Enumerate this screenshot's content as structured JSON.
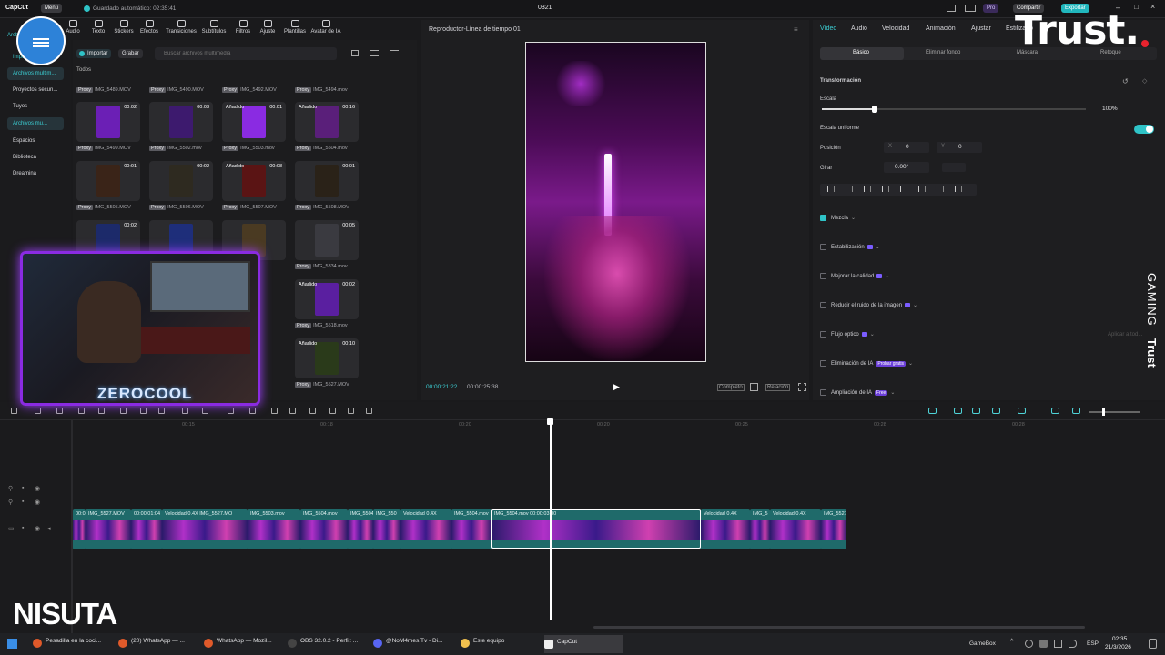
{
  "topbar": {
    "app_name": "CapCut",
    "menu_label": "Menú",
    "autosave": "Guardado automático: 02:35:41",
    "project_name": "0321",
    "pro_label": "Pro",
    "share_label": "Compartir",
    "export_label": "Exportar"
  },
  "toolbar": {
    "items": [
      "Audio",
      "Texto",
      "Stickers",
      "Efectos",
      "Transiciones",
      "Subtítulos",
      "Filtros",
      "Ajuste",
      "Plantillas",
      "Avatar de IA"
    ],
    "left_tab": "Archiv"
  },
  "leftnav": {
    "items": [
      "Importación",
      "Archivos multim...",
      "Proyectos secun...",
      "Tuyos",
      "Archivos mu...",
      "Espacios",
      "Biblioteca",
      "Dreamina"
    ]
  },
  "media": {
    "import_label": "Importar",
    "record_label": "Grabar",
    "search_placeholder": "Buscar archivos multimedia",
    "all_label": "Todos",
    "proxy_label": "Proxy",
    "added_label": "Añadido",
    "row0_captions": [
      "IMG_5489.MOV",
      "IMG_5490.MOV",
      "IMG_5492.MOV",
      "IMG_5494.mov"
    ],
    "grid": [
      {
        "dur": "00:02",
        "name": "IMG_5499.MOV",
        "added": false,
        "color": "#6b1fb5"
      },
      {
        "dur": "00:03",
        "name": "IMG_5502.mov",
        "added": false,
        "color": "#3d1a6e"
      },
      {
        "dur": "00:01",
        "name": "IMG_5503.mov",
        "added": true,
        "color": "#8a2be2"
      },
      {
        "dur": "00:16",
        "name": "IMG_5504.mov",
        "added": true,
        "color": "#5a1f7a"
      },
      {
        "dur": "00:01",
        "name": "IMG_5505.MOV",
        "added": false,
        "color": "#3a2418"
      },
      {
        "dur": "00:02",
        "name": "IMG_5506.MOV",
        "added": false,
        "color": "#2e2a20"
      },
      {
        "dur": "00:08",
        "name": "IMG_5507.MOV",
        "added": true,
        "color": "#5a1414"
      },
      {
        "dur": "00:01",
        "name": "IMG_5508.MOV",
        "added": false,
        "color": "#2a2218"
      },
      {
        "dur": "00:02",
        "name": "",
        "added": false,
        "color": "#1c2a6a"
      },
      {
        "dur": "",
        "name": "",
        "added": false,
        "color": "#1e2e7a"
      },
      {
        "dur": "",
        "name": "",
        "added": false,
        "color": "#4a3a22"
      },
      {
        "dur": "00:05",
        "name": "IMG_5334.mov",
        "added": false,
        "color": "#3a3a40"
      },
      {
        "dur": "00:02",
        "name": "IMG_5518.mov",
        "added": true,
        "color": "#5a1fa0"
      },
      {
        "dur": "00:10",
        "name": "IMG_5527.MOV",
        "added": true,
        "color": "#2a3a1a"
      }
    ]
  },
  "player": {
    "title": "Reproductor-Línea de tiempo 01",
    "current_time": "00:00:21:22",
    "total_time": "00:00:25:38",
    "ratio_label": "Completo",
    "proportion_label": "Relación"
  },
  "props": {
    "tabs": [
      "Vídeo",
      "Audio",
      "Velocidad",
      "Animación",
      "Ajustar",
      "Estilizado"
    ],
    "subtabs": [
      "Básico",
      "Eliminar fondo",
      "Máscara",
      "Retoque"
    ],
    "transform_label": "Transformación",
    "scale_label": "Escala",
    "scale_value": "100%",
    "scale_fraction": 0.2,
    "uniform_label": "Escala uniforme",
    "position_label": "Posición",
    "pos_x_label": "X",
    "pos_x": "0",
    "pos_y_label": "Y",
    "pos_y": "0",
    "rotate_label": "Girar",
    "rotate_value": "0.00°",
    "rotate_dash": "-",
    "options": [
      {
        "label": "Mezcla",
        "checked": true,
        "gem": false,
        "badge": ""
      },
      {
        "label": "Estabilización",
        "checked": false,
        "gem": true,
        "badge": ""
      },
      {
        "label": "Mejorar la calidad",
        "checked": false,
        "gem": true,
        "badge": ""
      },
      {
        "label": "Reducir el ruido de la imagen",
        "checked": false,
        "gem": true,
        "badge": ""
      },
      {
        "label": "Flujo óptico",
        "checked": false,
        "gem": true,
        "badge": ""
      },
      {
        "label": "Eliminación de IA",
        "checked": false,
        "gem": false,
        "badge": "Probar gratis"
      },
      {
        "label": "Ampliación de IA",
        "checked": false,
        "gem": false,
        "badge": "Free"
      }
    ],
    "apply_label": "Aplicar a tod..."
  },
  "timeline": {
    "ruler": [
      "00:15",
      "00:18",
      "00:20",
      "00:20",
      "00:25",
      "00:28",
      "00:28"
    ],
    "clips": [
      {
        "label": "00:0",
        "start": 80,
        "width": 14
      },
      {
        "label": "IMG_5527.MOV",
        "start": 94,
        "width": 50
      },
      {
        "label": "00:00:01:04",
        "start": 144,
        "width": 34
      },
      {
        "label": "Velocidad 0.4X  IMG_5527.MO",
        "start": 178,
        "width": 94
      },
      {
        "label": "IMG_5503.mov",
        "start": 272,
        "width": 58
      },
      {
        "label": "IMG_5504.mov",
        "start": 330,
        "width": 52
      },
      {
        "label": "IMG_5504",
        "start": 382,
        "width": 28
      },
      {
        "label": "IMG_550",
        "start": 410,
        "width": 30
      },
      {
        "label": "Velocidad 0.4X",
        "start": 440,
        "width": 56
      },
      {
        "label": "IMG_5504.mov",
        "start": 496,
        "width": 44
      },
      {
        "label": "IMG_5504.mov  00:00:03:00",
        "start": 540,
        "width": 230
      },
      {
        "label": "Velocidad 0.4X",
        "start": 770,
        "width": 54
      },
      {
        "label": "IMG_5",
        "start": 824,
        "width": 22
      },
      {
        "label": "Velocidad 0.4X",
        "start": 846,
        "width": 56
      },
      {
        "label": "IMG_5527",
        "start": 902,
        "width": 28
      }
    ]
  },
  "overlay": {
    "brand_trust": "Trust.",
    "gaming_side": "GAMING",
    "trust_side": "Trust",
    "streamer_tag": "ZEROCOOL",
    "nisuta": "NISUTA"
  },
  "taskbar": {
    "items": [
      {
        "label": "Pesadilla en la coci...",
        "color": "#e05a2a"
      },
      {
        "label": "(20) WhatsApp — ...",
        "color": "#e05a2a"
      },
      {
        "label": "WhatsApp — Mozil...",
        "color": "#e05a2a"
      },
      {
        "label": "OBS 32.0.2 - Perfil: ...",
        "color": "#444"
      },
      {
        "label": "@NoM4mes.Tv - Di...",
        "color": "#5865f2"
      },
      {
        "label": "Este equipo",
        "color": "#f2c14e"
      },
      {
        "label": "CapCut",
        "color": "#eee"
      }
    ],
    "gamebox": "GameBox",
    "lang": "ESP",
    "time": "02:35",
    "date": "21/3/2026"
  }
}
